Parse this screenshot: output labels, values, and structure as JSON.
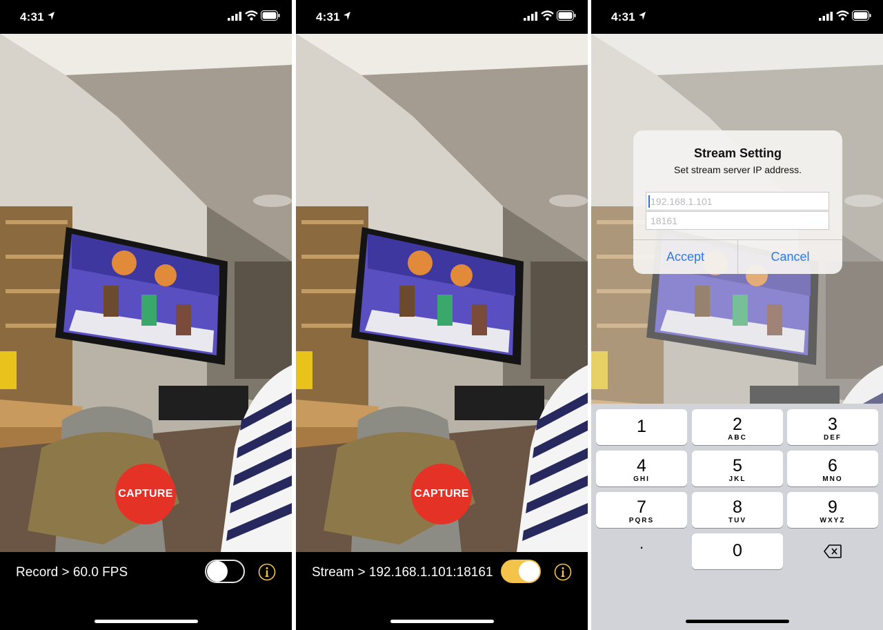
{
  "status": {
    "time": "4:31"
  },
  "screens": [
    {
      "capture_label": "CAPTURE",
      "mode_text": "Record > 60.0 FPS",
      "toggle_on": false
    },
    {
      "capture_label": "CAPTURE",
      "mode_text": "Stream > 192.168.1.101:18161",
      "toggle_on": true
    }
  ],
  "dialog": {
    "title": "Stream Setting",
    "message": "Set stream server IP address.",
    "ip_placeholder": "192.168.1.101",
    "port_placeholder": "18161",
    "accept_label": "Accept",
    "cancel_label": "Cancel"
  },
  "keypad": {
    "keys": [
      {
        "num": "1",
        "letters": ""
      },
      {
        "num": "2",
        "letters": "ABC"
      },
      {
        "num": "3",
        "letters": "DEF"
      },
      {
        "num": "4",
        "letters": "GHI"
      },
      {
        "num": "5",
        "letters": "JKL"
      },
      {
        "num": "6",
        "letters": "MNO"
      },
      {
        "num": "7",
        "letters": "PQRS"
      },
      {
        "num": "8",
        "letters": "TUV"
      },
      {
        "num": "9",
        "letters": "WXYZ"
      }
    ],
    "dot": ".",
    "zero": "0"
  },
  "colors": {
    "capture": "#e53226",
    "toggle_on": "#f4c34a",
    "info": "#f4c34a",
    "ios_blue": "#2f7ae5"
  }
}
